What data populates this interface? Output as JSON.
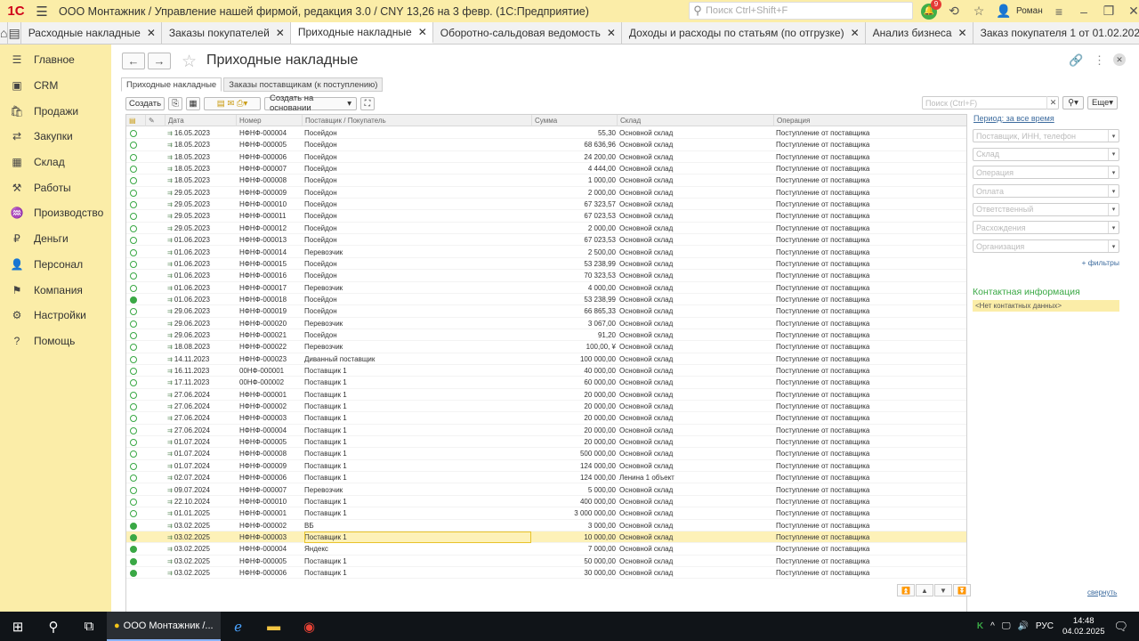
{
  "titlebar": {
    "logo": "1С",
    "title": "ООО Монтажник / Управление нашей фирмой, редакция 3.0 / CNY 13,26 на 3 февр.  (1С:Предприятие)",
    "search_placeholder": "Поиск Ctrl+Shift+F",
    "notif_count": "9",
    "user": "Роман"
  },
  "tabs": [
    {
      "label": "Расходные накладные"
    },
    {
      "label": "Заказы покупателей"
    },
    {
      "label": "Приходные накладные",
      "active": true
    },
    {
      "label": "Оборотно-сальдовая ведомость"
    },
    {
      "label": "Доходы и расходы по статьям (по отгрузке)"
    },
    {
      "label": "Анализ бизнеса"
    },
    {
      "label": "Заказ покупателя 1 от 01.02.2025"
    }
  ],
  "sidebar": [
    {
      "label": "Главное",
      "icon": "list-icon"
    },
    {
      "label": "CRM",
      "icon": "crm-icon"
    },
    {
      "label": "Продажи",
      "icon": "sales-icon"
    },
    {
      "label": "Закупки",
      "icon": "purchases-icon"
    },
    {
      "label": "Склад",
      "icon": "warehouse-icon"
    },
    {
      "label": "Работы",
      "icon": "works-icon"
    },
    {
      "label": "Производство",
      "icon": "production-icon"
    },
    {
      "label": "Деньги",
      "icon": "money-icon"
    },
    {
      "label": "Персонал",
      "icon": "personnel-icon"
    },
    {
      "label": "Компания",
      "icon": "company-icon"
    },
    {
      "label": "Настройки",
      "icon": "settings-icon"
    },
    {
      "label": "Помощь",
      "icon": "help-icon"
    }
  ],
  "page": {
    "title": "Приходные накладные"
  },
  "subtabs": [
    "Приходные накладные",
    "Заказы поставщикам (к поступлению)"
  ],
  "toolbar": {
    "create": "Создать",
    "create_based": "Создать на основании",
    "search_placeholder": "Поиск (Ctrl+F)",
    "more": "Еще"
  },
  "columns": [
    "Дата",
    "Номер",
    "Поставщик / Покупатель",
    "Сумма",
    "Склад",
    "Операция"
  ],
  "rows": [
    {
      "date": "16.05.2023",
      "num": "НФНФ-000004",
      "party": "Посейдон",
      "sum": "55,30",
      "wh": "Основной склад",
      "op": "Поступление от поставщика",
      "posted": false
    },
    {
      "date": "18.05.2023",
      "num": "НФНФ-000005",
      "party": "Посейдон",
      "sum": "68 636,96",
      "wh": "Основной склад",
      "op": "Поступление от поставщика",
      "posted": false
    },
    {
      "date": "18.05.2023",
      "num": "НФНФ-000006",
      "party": "Посейдон",
      "sum": "24 200,00",
      "wh": "Основной склад",
      "op": "Поступление от поставщика",
      "posted": false
    },
    {
      "date": "18.05.2023",
      "num": "НФНФ-000007",
      "party": "Посейдон",
      "sum": "4 444,00",
      "wh": "Основной склад",
      "op": "Поступление от поставщика",
      "posted": false
    },
    {
      "date": "18.05.2023",
      "num": "НФНФ-000008",
      "party": "Посейдон",
      "sum": "1 000,00",
      "wh": "Основной склад",
      "op": "Поступление от поставщика",
      "posted": false
    },
    {
      "date": "29.05.2023",
      "num": "НФНФ-000009",
      "party": "Посейдон",
      "sum": "2 000,00",
      "wh": "Основной склад",
      "op": "Поступление от поставщика",
      "posted": false
    },
    {
      "date": "29.05.2023",
      "num": "НФНФ-000010",
      "party": "Посейдон",
      "sum": "67 323,57",
      "wh": "Основной склад",
      "op": "Поступление от поставщика",
      "posted": false
    },
    {
      "date": "29.05.2023",
      "num": "НФНФ-000011",
      "party": "Посейдон",
      "sum": "67 023,53",
      "wh": "Основной склад",
      "op": "Поступление от поставщика",
      "posted": false
    },
    {
      "date": "29.05.2023",
      "num": "НФНФ-000012",
      "party": "Посейдон",
      "sum": "2 000,00",
      "wh": "Основной склад",
      "op": "Поступление от поставщика",
      "posted": false
    },
    {
      "date": "01.06.2023",
      "num": "НФНФ-000013",
      "party": "Посейдон",
      "sum": "67 023,53",
      "wh": "Основной склад",
      "op": "Поступление от поставщика",
      "posted": false
    },
    {
      "date": "01.06.2023",
      "num": "НФНФ-000014",
      "party": "Перевозчик",
      "sum": "2 500,00",
      "wh": "Основной склад",
      "op": "Поступление от поставщика",
      "posted": false
    },
    {
      "date": "01.06.2023",
      "num": "НФНФ-000015",
      "party": "Посейдон",
      "sum": "53 238,99",
      "wh": "Основной склад",
      "op": "Поступление от поставщика",
      "posted": false
    },
    {
      "date": "01.06.2023",
      "num": "НФНФ-000016",
      "party": "Посейдон",
      "sum": "70 323,53",
      "wh": "Основной склад",
      "op": "Поступление от поставщика",
      "posted": false
    },
    {
      "date": "01.06.2023",
      "num": "НФНФ-000017",
      "party": "Перевозчик",
      "sum": "4 000,00",
      "wh": "Основной склад",
      "op": "Поступление от поставщика",
      "posted": false
    },
    {
      "date": "01.06.2023",
      "num": "НФНФ-000018",
      "party": "Посейдон",
      "sum": "53 238,99",
      "wh": "Основной склад",
      "op": "Поступление от поставщика",
      "posted": true
    },
    {
      "date": "29.06.2023",
      "num": "НФНФ-000019",
      "party": "Посейдон",
      "sum": "66 865,33",
      "wh": "Основной склад",
      "op": "Поступление от поставщика",
      "posted": false
    },
    {
      "date": "29.06.2023",
      "num": "НФНФ-000020",
      "party": "Перевозчик",
      "sum": "3 067,00",
      "wh": "Основной склад",
      "op": "Поступление от поставщика",
      "posted": false
    },
    {
      "date": "29.06.2023",
      "num": "НФНФ-000021",
      "party": "Посейдон",
      "sum": "91,20",
      "wh": "Основной склад",
      "op": "Поступление от поставщика",
      "posted": false
    },
    {
      "date": "18.08.2023",
      "num": "НФНФ-000022",
      "party": "Перевозчик",
      "sum": "100,00, ¥",
      "wh": "Основной склад",
      "op": "Поступление от поставщика",
      "posted": false
    },
    {
      "date": "14.11.2023",
      "num": "НФНФ-000023",
      "party": "Диванный поставщик",
      "sum": "100 000,00",
      "wh": "Основной склад",
      "op": "Поступление от поставщика",
      "posted": false
    },
    {
      "date": "16.11.2023",
      "num": "00НФ-000001",
      "party": "Поставщик 1",
      "sum": "40 000,00",
      "wh": "Основной склад",
      "op": "Поступление от поставщика",
      "posted": false
    },
    {
      "date": "17.11.2023",
      "num": "00НФ-000002",
      "party": "Поставщик 1",
      "sum": "60 000,00",
      "wh": "Основной склад",
      "op": "Поступление от поставщика",
      "posted": false
    },
    {
      "date": "27.06.2024",
      "num": "НФНФ-000001",
      "party": "Поставщик 1",
      "sum": "20 000,00",
      "wh": "Основной склад",
      "op": "Поступление от поставщика",
      "posted": false
    },
    {
      "date": "27.06.2024",
      "num": "НФНФ-000002",
      "party": "Поставщик 1",
      "sum": "20 000,00",
      "wh": "Основной склад",
      "op": "Поступление от поставщика",
      "posted": false
    },
    {
      "date": "27.06.2024",
      "num": "НФНФ-000003",
      "party": "Поставщик 1",
      "sum": "20 000,00",
      "wh": "Основной склад",
      "op": "Поступление от поставщика",
      "posted": false
    },
    {
      "date": "27.06.2024",
      "num": "НФНФ-000004",
      "party": "Поставщик 1",
      "sum": "20 000,00",
      "wh": "Основной склад",
      "op": "Поступление от поставщика",
      "posted": false
    },
    {
      "date": "01.07.2024",
      "num": "НФНФ-000005",
      "party": "Поставщик 1",
      "sum": "20 000,00",
      "wh": "Основной склад",
      "op": "Поступление от поставщика",
      "posted": false
    },
    {
      "date": "01.07.2024",
      "num": "НФНФ-000008",
      "party": "Поставщик 1",
      "sum": "500 000,00",
      "wh": "Основной склад",
      "op": "Поступление от поставщика",
      "posted": false
    },
    {
      "date": "01.07.2024",
      "num": "НФНФ-000009",
      "party": "Поставщик 1",
      "sum": "124 000,00",
      "wh": "Основной склад",
      "op": "Поступление от поставщика",
      "posted": false
    },
    {
      "date": "02.07.2024",
      "num": "НФНФ-000006",
      "party": "Поставщик 1",
      "sum": "124 000,00",
      "wh": "Ленина 1 объект",
      "op": "Поступление от поставщика",
      "posted": false
    },
    {
      "date": "09.07.2024",
      "num": "НФНФ-000007",
      "party": "Перевозчик",
      "sum": "5 000,00",
      "wh": "Основной склад",
      "op": "Поступление от поставщика",
      "posted": false
    },
    {
      "date": "22.10.2024",
      "num": "НФНФ-000010",
      "party": "Поставщик 1",
      "sum": "400 000,00",
      "wh": "Основной склад",
      "op": "Поступление от поставщика",
      "posted": false
    },
    {
      "date": "01.01.2025",
      "num": "НФНФ-000001",
      "party": "Поставщик 1",
      "sum": "3 000 000,00",
      "wh": "Основной склад",
      "op": "Поступление от поставщика",
      "posted": false
    },
    {
      "date": "03.02.2025",
      "num": "НФНФ-000002",
      "party": "ВБ",
      "sum": "3 000,00",
      "wh": "Основной склад",
      "op": "Поступление от поставщика",
      "posted": true
    },
    {
      "date": "03.02.2025",
      "num": "НФНФ-000003",
      "party": "Поставщик 1",
      "sum": "10 000,00",
      "wh": "Основной склад",
      "op": "Поступление от поставщика",
      "posted": true,
      "selected": true
    },
    {
      "date": "03.02.2025",
      "num": "НФНФ-000004",
      "party": "Яндекс",
      "sum": "7 000,00",
      "wh": "Основной склад",
      "op": "Поступление от поставщика",
      "posted": true
    },
    {
      "date": "03.02.2025",
      "num": "НФНФ-000005",
      "party": "Поставщик 1",
      "sum": "50 000,00",
      "wh": "Основной склад",
      "op": "Поступление от поставщика",
      "posted": true
    },
    {
      "date": "03.02.2025",
      "num": "НФНФ-000006",
      "party": "Поставщик 1",
      "sum": "30 000,00",
      "wh": "Основной склад",
      "op": "Поступление от поставщика",
      "posted": true
    }
  ],
  "filters": {
    "period": "Период: за все время",
    "fields": [
      "Поставщик, ИНН, телефон",
      "Склад",
      "Операция",
      "Оплата",
      "Ответственный",
      "Расхождения",
      "Организация"
    ],
    "more": "+ фильтры"
  },
  "contact": {
    "title": "Контактная информация",
    "none": "<Нет контактных данных>"
  },
  "collapse": "свернуть",
  "taskbar": {
    "app": "ООО Монтажник /...",
    "lang": "РУС",
    "time": "14:48",
    "date": "04.02.2025"
  },
  "colors": {
    "accent": "#fbeda8",
    "posted": "#3aa845",
    "link": "#3c6b9e"
  }
}
